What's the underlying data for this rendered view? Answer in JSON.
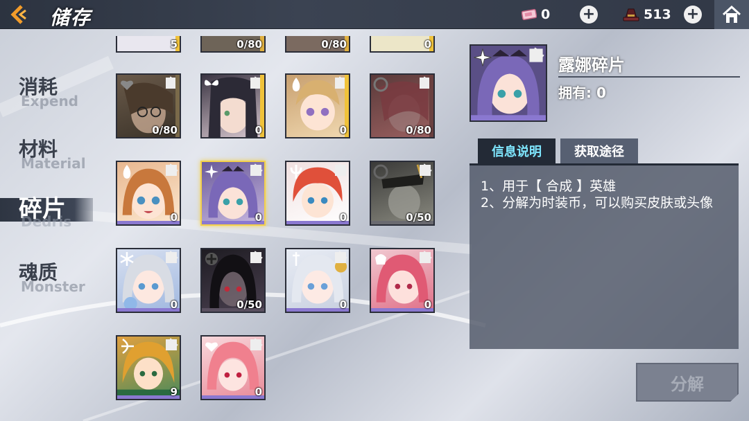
{
  "header": {
    "title": "储存",
    "currency_a": "0",
    "currency_b": "513"
  },
  "nav": [
    {
      "cn": "消耗",
      "en": "Expend"
    },
    {
      "cn": "材料",
      "en": "Material"
    },
    {
      "cn": "碎片",
      "en": "Dedris"
    },
    {
      "cn": "魂质",
      "en": "Monster"
    }
  ],
  "grid": {
    "top_row": [
      "5",
      "0/80",
      "0/80",
      "0"
    ],
    "rows": [
      [
        "0/80",
        "0",
        "0",
        "0/80"
      ],
      [
        "0",
        "0",
        "0",
        "0/50"
      ],
      [
        "0",
        "0/50",
        "0",
        "0"
      ],
      [
        "9",
        "0"
      ]
    ]
  },
  "detail": {
    "hero_name": "露娜碎片",
    "owned": "拥有: 0",
    "tab_info": "信息说明",
    "tab_source": "获取途径",
    "line1": "1、用于【 合成 】英雄",
    "line2": "2、分解为时装币，可以购买皮肤或头像",
    "decompose": "分解"
  },
  "colors": {
    "accent_cyan": "#7fe7ff",
    "selected_border": "#f3d04b",
    "count_zero": "#ffffff"
  }
}
